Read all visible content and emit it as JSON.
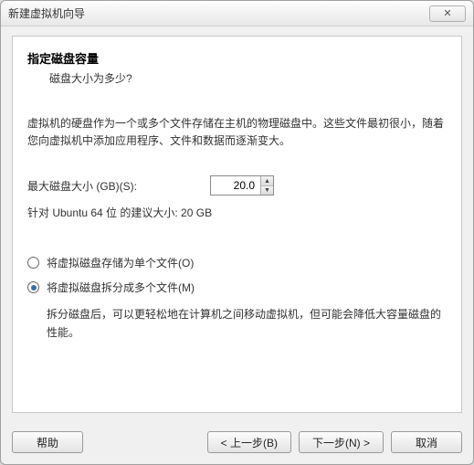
{
  "window": {
    "title": "新建虚拟机向导",
    "close_glyph": "✕"
  },
  "header": {
    "title": "指定磁盘容量",
    "subtitle": "磁盘大小为多少?"
  },
  "description": "虚拟机的硬盘作为一个或多个文件存储在主机的物理磁盘中。这些文件最初很小，随着您向虚拟机中添加应用程序、文件和数据而逐渐变大。",
  "disk": {
    "size_label": "最大磁盘大小 (GB)(S):",
    "size_value": "20.0",
    "recommended": "针对 Ubuntu 64 位 的建议大小: 20 GB"
  },
  "storage": {
    "single_label": "将虚拟磁盘存储为单个文件(O)",
    "split_label": "将虚拟磁盘拆分成多个文件(M)",
    "split_desc": "拆分磁盘后，可以更轻松地在计算机之间移动虚拟机，但可能会降低大容量磁盘的性能。",
    "selected": "split"
  },
  "buttons": {
    "help": "帮助",
    "back": "< 上一步(B)",
    "next": "下一步(N) >",
    "cancel": "取消"
  }
}
